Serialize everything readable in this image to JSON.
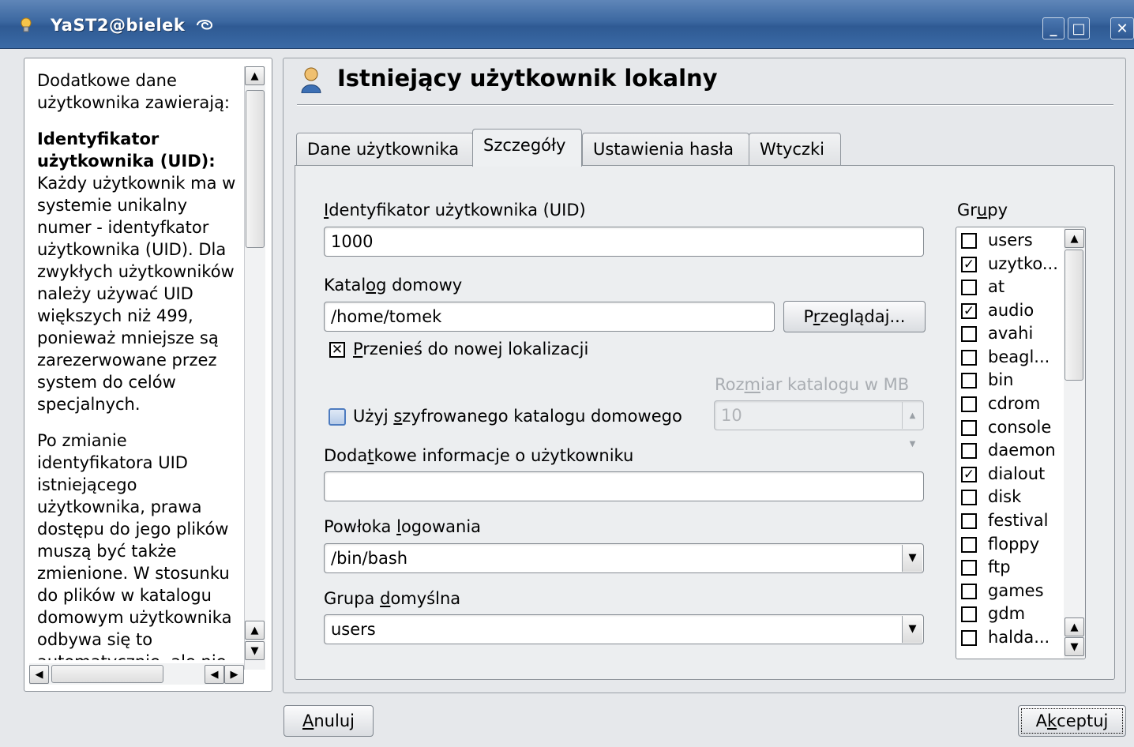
{
  "window": {
    "title": "YaST2@bielek",
    "minimize_glyph": "_",
    "maximize_glyph": "□",
    "close_glyph": "✕"
  },
  "help": {
    "intro": "Dodatkowe dane użytkownika zawierają:",
    "uid_heading": "Identyfikator użytkownika (UID):",
    "uid_text": "Każdy użytkownik ma w systemie unikalny numer - identyfkator użytkownika (UID). Dla zwykłych użytkowników należy używać UID większych niż 499, ponieważ mniejsze są zarezerwowane przez system do celów specjalnych.",
    "change_text": "Po zmianie identyfikatora UID istniejącego użytkownika, prawa dostępu do jego plików muszą być także zmienione. W stosunku do plików w katalogu domowym użytkownika odbywa się to automatycznie, ale nie"
  },
  "main": {
    "heading": "Istniejący użytkownik lokalny",
    "heading_icon": "user-icon",
    "tabs": [
      {
        "label": "Dane użytkownika"
      },
      {
        "label": "Szczegóły"
      },
      {
        "label": "Ustawienia hasła"
      },
      {
        "label": "Wtyczki"
      }
    ],
    "active_tab": "Szczegóły"
  },
  "form": {
    "uid": {
      "label_pre": "",
      "label_u": "I",
      "label_post": "dentyfikator użytkownika (UID)",
      "value": "1000"
    },
    "home": {
      "label_pre": "Katal",
      "label_u": "o",
      "label_post": "g domowy",
      "value": "/home/tomek"
    },
    "browse": {
      "pre": "P",
      "u": "r",
      "post": "zeglądaj..."
    },
    "move": {
      "u": "P",
      "post": "rzenieś do nowej lokalizacji",
      "checked": true
    },
    "dirsize": {
      "pre": "Roz",
      "u": "m",
      "post": "iar katalogu w MB",
      "value": "10"
    },
    "encrypt": {
      "pre": "Użyj ",
      "u": "s",
      "post": "zyfrowanego katalogu domowego",
      "checked": false
    },
    "extra": {
      "pre": "Doda",
      "u": "t",
      "post": "kowe informacje o użytkowniku",
      "value": ""
    },
    "shell": {
      "pre": "Powłoka ",
      "u": "l",
      "post": "ogowania",
      "value": "/bin/bash"
    },
    "defgroup": {
      "pre": "Grupa ",
      "u": "d",
      "post": "omyślna",
      "value": "users"
    }
  },
  "groups": {
    "label_pre": "Gr",
    "label_u": "u",
    "label_post": "py",
    "items": [
      {
        "name": "users",
        "checked": false
      },
      {
        "name": "uzytko...",
        "checked": true
      },
      {
        "name": "at",
        "checked": false
      },
      {
        "name": "audio",
        "checked": true
      },
      {
        "name": "avahi",
        "checked": false
      },
      {
        "name": "beagl...",
        "checked": false
      },
      {
        "name": "bin",
        "checked": false
      },
      {
        "name": "cdrom",
        "checked": false
      },
      {
        "name": "console",
        "checked": false
      },
      {
        "name": "daemon",
        "checked": false
      },
      {
        "name": "dialout",
        "checked": true
      },
      {
        "name": "disk",
        "checked": false
      },
      {
        "name": "festival",
        "checked": false
      },
      {
        "name": "floppy",
        "checked": false
      },
      {
        "name": "ftp",
        "checked": false
      },
      {
        "name": "games",
        "checked": false
      },
      {
        "name": "gdm",
        "checked": false
      },
      {
        "name": "halda...",
        "checked": false
      }
    ]
  },
  "footer": {
    "cancel": {
      "u": "A",
      "post": "nuluj"
    },
    "accept": {
      "pre": "A",
      "u": "k",
      "post": "ceptuj"
    }
  }
}
